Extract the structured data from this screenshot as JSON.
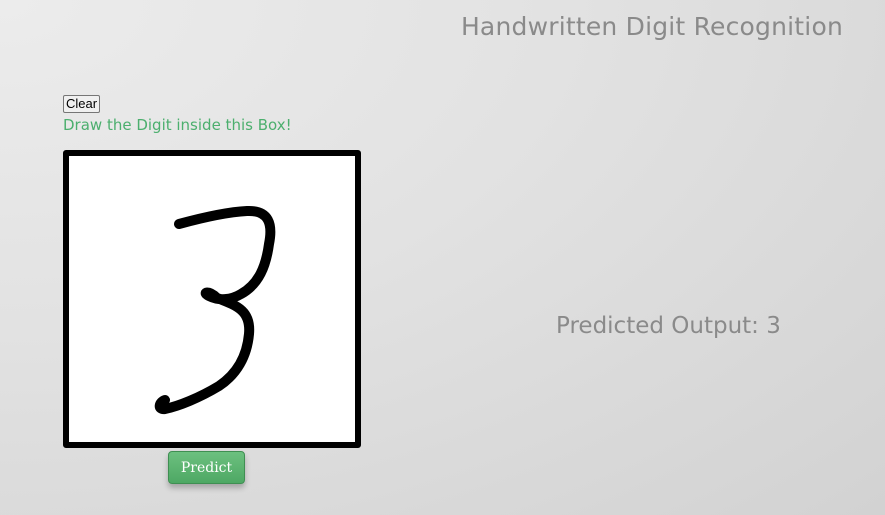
{
  "header": {
    "title": "Handwritten Digit Recognition"
  },
  "controls": {
    "clear_label": "Clear",
    "instruction": "Draw the Digit inside this Box!",
    "predict_label": "Predict"
  },
  "result": {
    "label": "Predicted Output:",
    "value": "3",
    "text": "Predicted Output: 3"
  },
  "canvas": {
    "stroke_color": "#000000",
    "background_color": "#ffffff",
    "drawn_digit": "3"
  },
  "colors": {
    "instruction_text": "#4caf6e",
    "predict_button": "#5cb870",
    "title_text": "#8a8a8a"
  }
}
